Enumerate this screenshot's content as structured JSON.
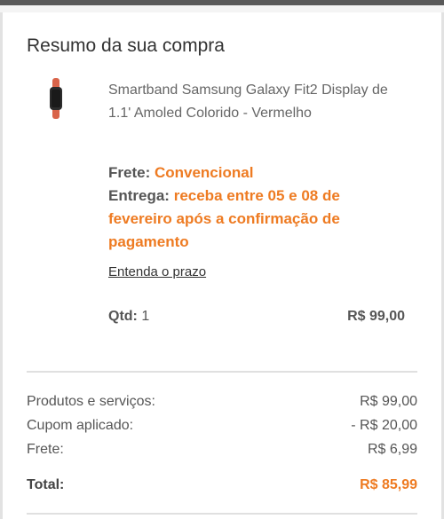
{
  "summary": {
    "title": "Resumo da sua compra",
    "product": {
      "name": "Smartband Samsung Galaxy Fit2 Display de 1.1' Amoled Colorido - Vermelho",
      "thumbnail_icon": "smartband-image"
    },
    "shipping": {
      "frete_label": "Frete:",
      "frete_value": "Convencional",
      "entrega_label": "Entrega:",
      "entrega_value": "receba entre 05 e 08 de fevereiro após a confirmação de pagamento",
      "link_label": "Entenda o prazo"
    },
    "quantity": {
      "label": "Qtd:",
      "value": "1",
      "price": "R$ 99,00"
    }
  },
  "totals": {
    "rows": [
      {
        "label": "Produtos e serviços:",
        "value": "R$ 99,00"
      },
      {
        "label": "Cupom aplicado:",
        "value": "- R$ 20,00"
      },
      {
        "label": "Frete:",
        "value": "R$ 6,99"
      }
    ],
    "total_label": "Total:",
    "total_value": "R$ 85,99"
  },
  "colors": {
    "accent": "#ee7b22",
    "text": "#555555",
    "band": "#d9644a"
  }
}
